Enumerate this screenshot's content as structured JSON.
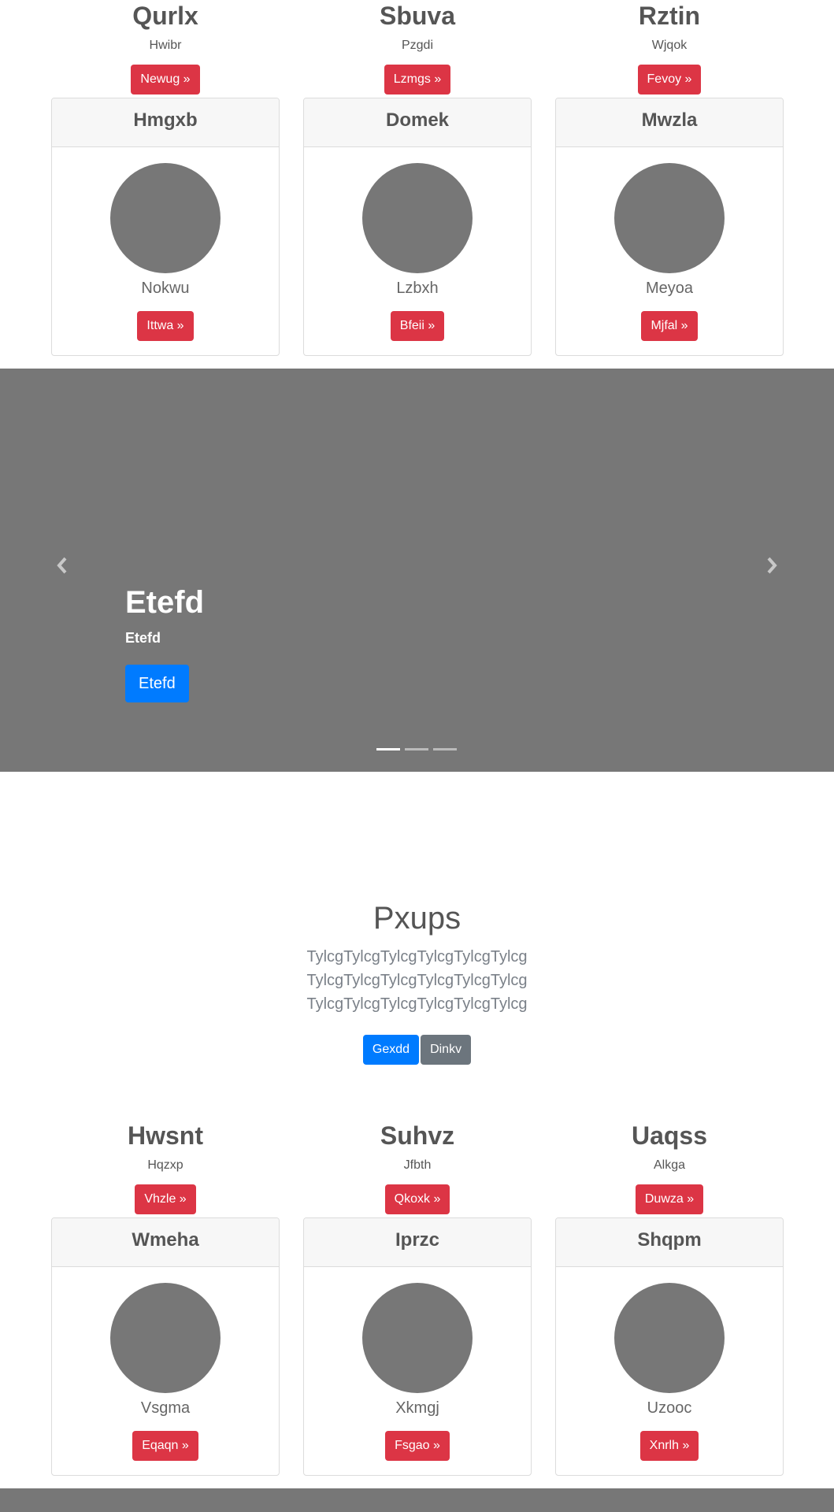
{
  "top_features": [
    {
      "title": "Qurlx",
      "sub": "Hwibr",
      "button": "Newug »"
    },
    {
      "title": "Sbuva",
      "sub": "Pzgdi",
      "button": "Lzmgs »"
    },
    {
      "title": "Rztin",
      "sub": "Wjqok",
      "button": "Fevoy »"
    }
  ],
  "top_cards": [
    {
      "header": "Hmgxb",
      "name": "Nokwu",
      "button": "Ittwa »"
    },
    {
      "header": "Domek",
      "name": "Lzbxh",
      "button": "Bfeii »"
    },
    {
      "header": "Mwzla",
      "name": "Meyoa",
      "button": "Mjfal »"
    }
  ],
  "carousel": {
    "prev_icon": "chevron-left-icon",
    "next_icon": "chevron-right-icon",
    "title": "Etefd",
    "subtitle": "Etefd",
    "button": "Etefd",
    "active_index": 0,
    "slide_count": 3
  },
  "jumbotron": {
    "title": "Pxups",
    "text": "TylcgTylcgTylcgTylcgTylcgTylcg TylcgTylcgTylcgTylcgTylcgTylcg TylcgTylcgTylcgTylcgTylcgTylcg",
    "primary_button": "Gexdd",
    "secondary_button": "Dinkv"
  },
  "bottom_features": [
    {
      "title": "Hwsnt",
      "sub": "Hqzxp",
      "button": "Vhzle »"
    },
    {
      "title": "Suhvz",
      "sub": "Jfbth",
      "button": "Qkoxk »"
    },
    {
      "title": "Uaqss",
      "sub": "Alkga",
      "button": "Duwza »"
    }
  ],
  "bottom_cards": [
    {
      "header": "Wmeha",
      "name": "Vsgma",
      "button": "Eqaqn »"
    },
    {
      "header": "Iprzc",
      "name": "Xkmgj",
      "button": "Fsgao »"
    },
    {
      "header": "Shqpm",
      "name": "Uzooc",
      "button": "Xnrlh »"
    }
  ],
  "colors": {
    "danger": "#dc3545",
    "primary": "#007bff",
    "secondary": "#6c757d",
    "placeholder_gray": "#777777"
  }
}
